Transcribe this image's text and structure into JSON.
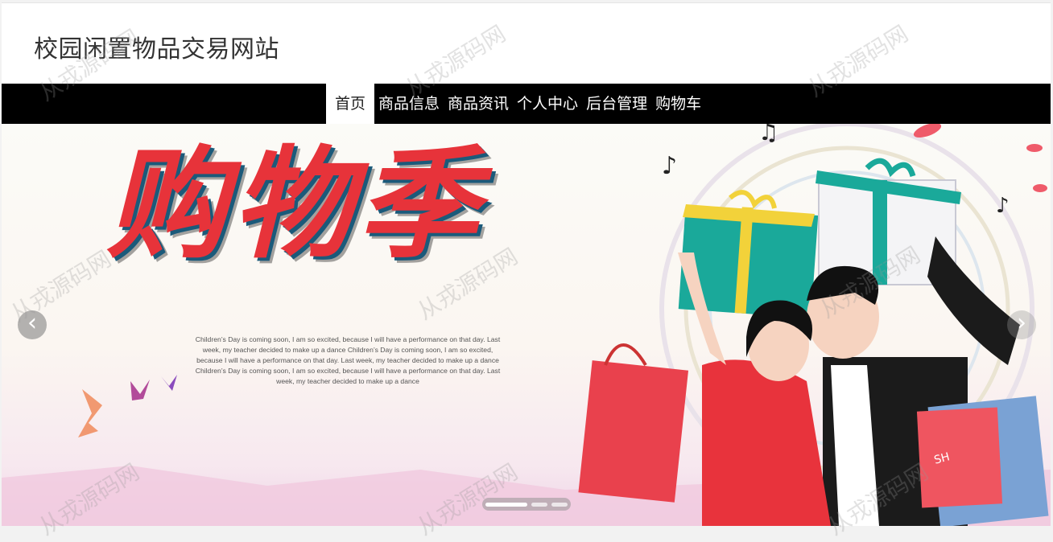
{
  "site": {
    "title": "校园闲置物品交易网站"
  },
  "nav": {
    "items": [
      {
        "label": "首页",
        "active": true
      },
      {
        "label": "商品信息"
      },
      {
        "label": "商品资讯"
      },
      {
        "label": "个人中心"
      },
      {
        "label": "后台管理"
      },
      {
        "label": "购物车"
      }
    ]
  },
  "carousel": {
    "headline": "购物季",
    "body_text": "Children’s Day is coming soon, I am so excited, because I will have a performance on that day. Last week, my teacher decided to make up a dance Children’s Day is coming soon, I am so excited, because I will have a performance on that day. Last week, my teacher decided to make up a dance Children’s Day is coming soon, I am so excited, because I will have a performance on that day. Last week, my teacher decided to make up a dance",
    "bag_label": "SH",
    "prev_icon": "‹",
    "next_icon": "›",
    "slide_count": 3,
    "active_slide": 1
  },
  "watermark": {
    "text": "从戎源码网"
  },
  "colors": {
    "navbar_bg": "#000000",
    "nav_active_bg": "#ffffff",
    "headline_red": "#e7333a",
    "gift_teal": "#1aa99a"
  }
}
